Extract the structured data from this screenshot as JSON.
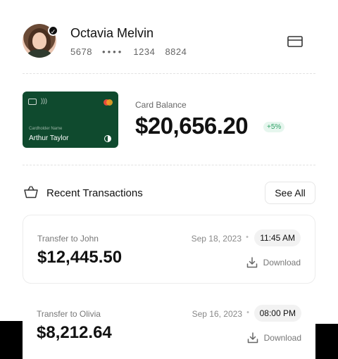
{
  "profile": {
    "name": "Octavia Melvin",
    "card_number": {
      "part1": "5678",
      "masked": "••••",
      "part3": "1234",
      "part4": "8824"
    }
  },
  "card": {
    "holder_label": "Cardholder Name",
    "holder_name": "Arthur Taylor"
  },
  "balance": {
    "label": "Card Balance",
    "value": "$20,656.20",
    "change": "+5%"
  },
  "transactions_section": {
    "title": "Recent Transactions",
    "see_all_label": "See All"
  },
  "transactions": [
    {
      "label": "Transfer to John",
      "amount": "$12,445.50",
      "date": "Sep 18, 2023",
      "time": "11:45 AM",
      "download_label": "Download"
    },
    {
      "label": "Transfer to Olivia",
      "amount": "$8,212.64",
      "date": "Sep 16, 2023",
      "time": "08:00 PM",
      "download_label": "Download"
    }
  ],
  "colors": {
    "card_green": "#0f4a2e",
    "badge_green": "#2c9f63",
    "badge_bg": "#e6f6ee"
  }
}
